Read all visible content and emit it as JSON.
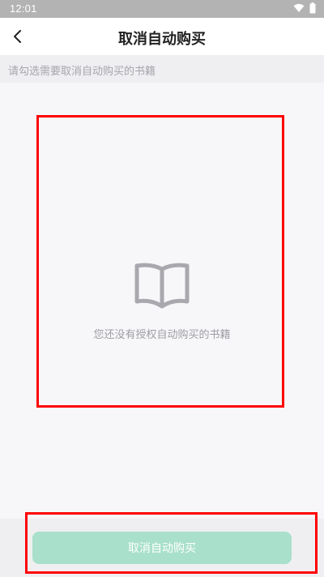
{
  "status_bar": {
    "time": "12:01",
    "icons": [
      "wifi-icon",
      "battery-icon"
    ]
  },
  "header": {
    "title": "取消自动购买",
    "back_icon": "chevron-left-icon"
  },
  "hint": {
    "text": "请勾选需要取消自动购买的书籍"
  },
  "empty_state": {
    "icon": "open-book-icon",
    "message": "您还没有授权自动购买的书籍"
  },
  "footer": {
    "cancel_button_label": "取消自动购买"
  },
  "colors": {
    "accent_disabled": "#a9e0cb",
    "highlight": "#ff0000",
    "status_bar": "#b3b3b3"
  }
}
